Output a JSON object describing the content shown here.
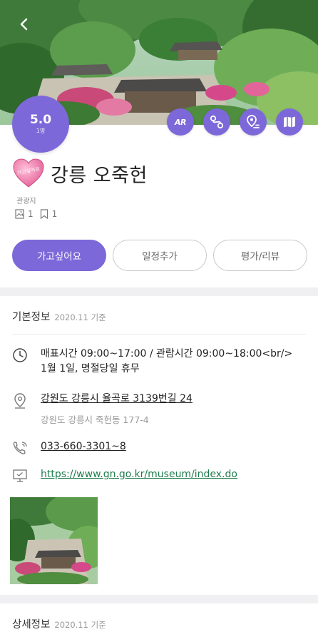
{
  "place": {
    "title": "강릉 오죽헌",
    "category": "관광지",
    "heart_badge": "가고싶어요",
    "photo_count": "1",
    "bookmark_count": "1"
  },
  "rating": {
    "score": "5.0",
    "count": "1명"
  },
  "action_icons": [
    {
      "name": "ar",
      "label": "AR"
    },
    {
      "name": "course",
      "label": ""
    },
    {
      "name": "map",
      "label": ""
    },
    {
      "name": "guide",
      "label": ""
    }
  ],
  "buttons": {
    "want_to_go": "가고싶어요",
    "add_schedule": "일정추가",
    "review": "평가/리뷰"
  },
  "basic_info": {
    "title": "기본정보",
    "date": "2020.11 기준",
    "hours_line1": "매표시간 09:00~17:00 / 관람시간 09:00~18:00<br/>",
    "hours_line2": "1월 1일, 명절당일 휴무",
    "address": "강원도 강릉시 율곡로 3139번길 24",
    "address_old": "강원도 강릉시 죽헌동 177-4",
    "phone": "033-660-3301~8",
    "website": "https://www.gn.go.kr/museum/index.do"
  },
  "detail_info": {
    "title": "상세정보",
    "date": "2020.11 기준"
  },
  "colors": {
    "accent": "#7d68d9",
    "link_green": "#1f7d4d",
    "heart_pink": "#ef7fae"
  },
  "icons": [
    "back-arrow-icon",
    "ar-icon",
    "course-icon",
    "map-pin-icon",
    "book-map-icon",
    "clock-icon",
    "location-icon",
    "phone-icon",
    "monitor-icon",
    "photo-icon",
    "bookmark-icon",
    "heart-icon"
  ]
}
